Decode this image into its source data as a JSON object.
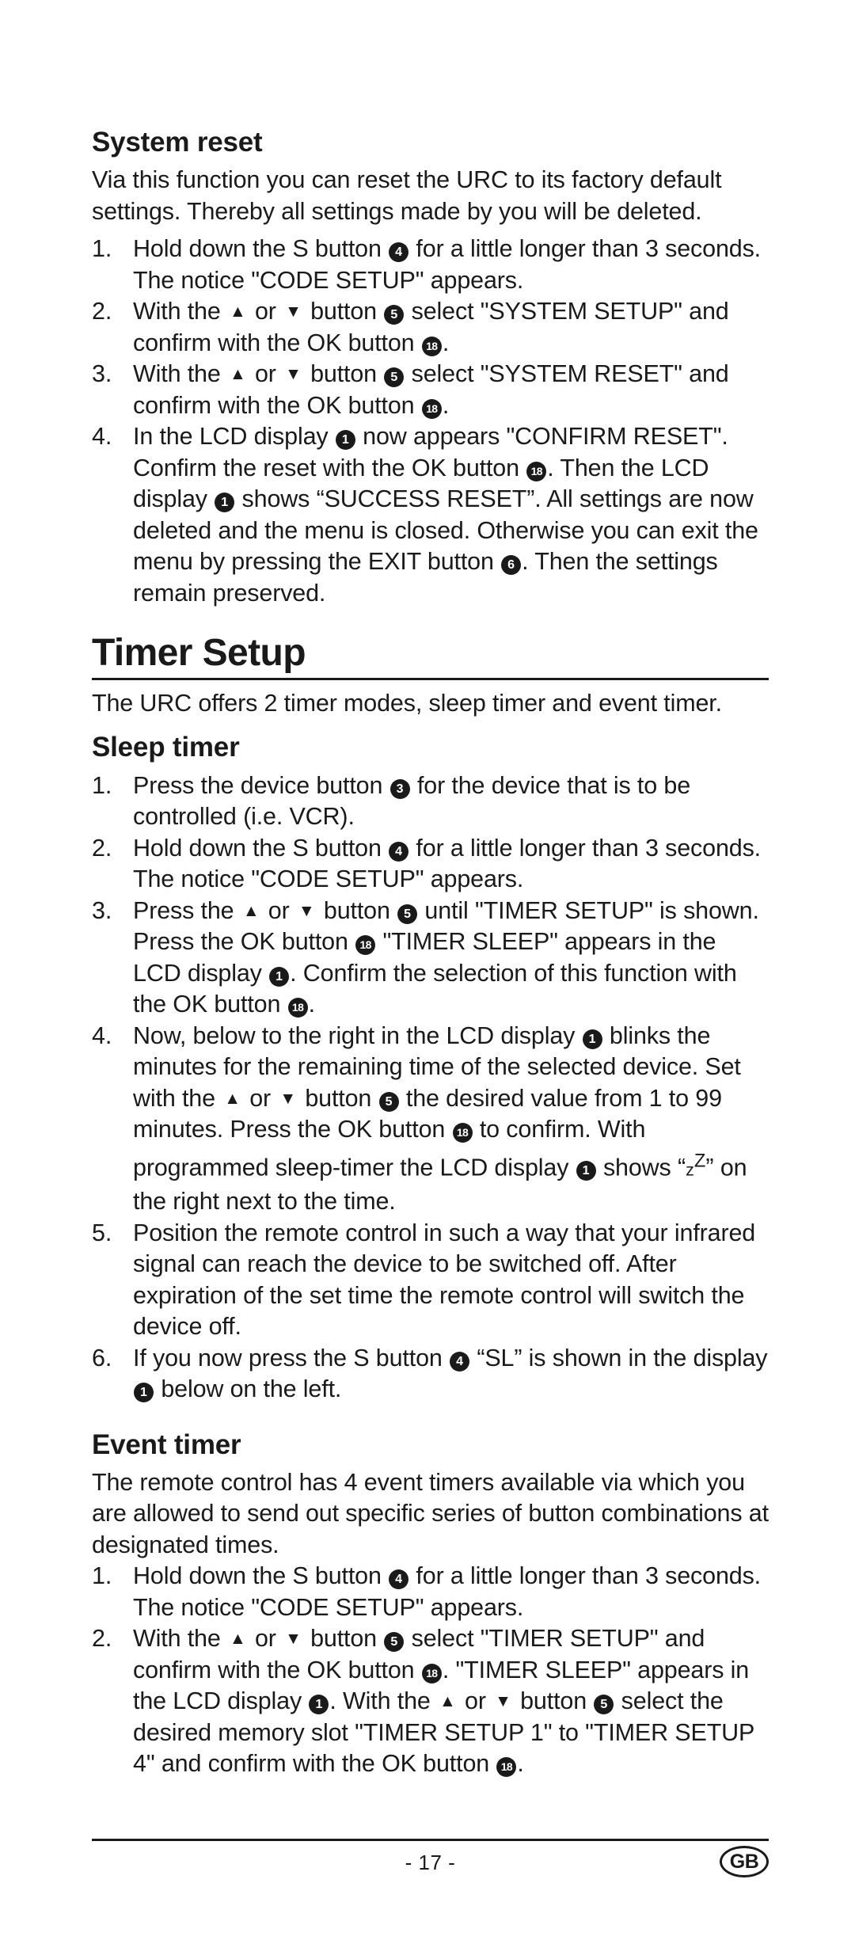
{
  "page": {
    "number_label": "- 17 -",
    "region_badge": "GB"
  },
  "sections": {
    "system_reset": {
      "heading": "System reset",
      "intro": "Via this function you can reset the URC to its factory default settings. Thereby all settings made by you will be deleted.",
      "steps": [
        {
          "num": "1.",
          "parts": [
            {
              "t": "text",
              "v": "Hold down the S button "
            },
            {
              "t": "badge",
              "v": "4"
            },
            {
              "t": "text",
              "v": " for a little longer than 3 seconds. The notice \"CODE SETUP\" appears."
            }
          ]
        },
        {
          "num": "2.",
          "parts": [
            {
              "t": "text",
              "v": "With the "
            },
            {
              "t": "arrow",
              "v": "▲"
            },
            {
              "t": "text",
              "v": " or "
            },
            {
              "t": "arrow",
              "v": "▼"
            },
            {
              "t": "text",
              "v": " button "
            },
            {
              "t": "badge",
              "v": "5"
            },
            {
              "t": "text",
              "v": " select \"SYSTEM SETUP\" and confirm with the OK button "
            },
            {
              "t": "badge",
              "v": "18"
            },
            {
              "t": "text",
              "v": "."
            }
          ]
        },
        {
          "num": "3.",
          "parts": [
            {
              "t": "text",
              "v": "With the "
            },
            {
              "t": "arrow",
              "v": "▲"
            },
            {
              "t": "text",
              "v": " or "
            },
            {
              "t": "arrow",
              "v": "▼"
            },
            {
              "t": "text",
              "v": " button "
            },
            {
              "t": "badge",
              "v": "5"
            },
            {
              "t": "text",
              "v": " select \"SYSTEM RESET\" and confirm with the OK button "
            },
            {
              "t": "badge",
              "v": "18"
            },
            {
              "t": "text",
              "v": "."
            }
          ]
        },
        {
          "num": "4.",
          "parts": [
            {
              "t": "text",
              "v": "In the LCD display "
            },
            {
              "t": "badge",
              "v": "1"
            },
            {
              "t": "text",
              "v": " now appears \"CONFIRM RESET\". Confirm the reset with the OK button "
            },
            {
              "t": "badge",
              "v": "18"
            },
            {
              "t": "text",
              "v": ". Then the LCD display "
            },
            {
              "t": "badge",
              "v": "1"
            },
            {
              "t": "text",
              "v": " shows “SUCCESS RESET”. All settings are now deleted and the menu is closed. Otherwise you can exit the menu by pressing the EXIT button "
            },
            {
              "t": "badge",
              "v": "6"
            },
            {
              "t": "text",
              "v": ". Then the settings remain preserved."
            }
          ]
        }
      ]
    },
    "timer_setup": {
      "heading": "Timer Setup",
      "intro": "The URC offers 2 timer modes, sleep timer and event timer."
    },
    "sleep_timer": {
      "heading": "Sleep timer",
      "steps": [
        {
          "num": "1.",
          "parts": [
            {
              "t": "text",
              "v": "Press the device button "
            },
            {
              "t": "badge",
              "v": "3"
            },
            {
              "t": "text",
              "v": " for the device that is to be controlled (i.e. VCR)."
            }
          ]
        },
        {
          "num": "2.",
          "parts": [
            {
              "t": "text",
              "v": "Hold down the S button "
            },
            {
              "t": "badge",
              "v": "4"
            },
            {
              "t": "text",
              "v": " for a little longer than 3 seconds. The notice \"CODE SETUP\" appears."
            }
          ]
        },
        {
          "num": "3.",
          "parts": [
            {
              "t": "text",
              "v": "Press the "
            },
            {
              "t": "arrow",
              "v": "▲"
            },
            {
              "t": "text",
              "v": " or "
            },
            {
              "t": "arrow",
              "v": "▼"
            },
            {
              "t": "text",
              "v": " button "
            },
            {
              "t": "badge",
              "v": "5"
            },
            {
              "t": "text",
              "v": " until \"TIMER SETUP\" is shown. Press the OK button "
            },
            {
              "t": "badge",
              "v": "18"
            },
            {
              "t": "text",
              "v": " \"TIMER SLEEP\" appears in the LCD display "
            },
            {
              "t": "badge",
              "v": "1"
            },
            {
              "t": "text",
              "v": ".  Confirm the selection of this function with the OK button "
            },
            {
              "t": "badge",
              "v": "18"
            },
            {
              "t": "text",
              "v": "."
            }
          ]
        },
        {
          "num": "4.",
          "parts": [
            {
              "t": "text",
              "v": "Now, below to the right in the LCD display "
            },
            {
              "t": "badge",
              "v": "1"
            },
            {
              "t": "text",
              "v": " blinks the minutes for the remaining time of the selected device. Set with the "
            },
            {
              "t": "arrow",
              "v": "▲"
            },
            {
              "t": "text",
              "v": " or "
            },
            {
              "t": "arrow",
              "v": "▼"
            },
            {
              "t": "text",
              "v": " button "
            },
            {
              "t": "badge",
              "v": "5"
            },
            {
              "t": "text",
              "v": " the desired value from 1 to 99 minutes. Press the OK button "
            },
            {
              "t": "badge",
              "v": "18"
            },
            {
              "t": "text",
              "v": " to confirm. With programmed sleep-timer the LCD display "
            },
            {
              "t": "badge",
              "v": "1"
            },
            {
              "t": "text",
              "v": " shows "
            },
            {
              "t": "zz",
              "v": "“zᶻ”"
            },
            {
              "t": "text",
              "v": " on the right next to the time."
            }
          ]
        },
        {
          "num": "5.",
          "parts": [
            {
              "t": "text",
              "v": "Position the remote control in such a way that your infrared signal can reach the device to be switched off. After expiration of the set time the remote control will switch the device off."
            }
          ]
        },
        {
          "num": "6.",
          "parts": [
            {
              "t": "text",
              "v": "If you now press the S button "
            },
            {
              "t": "badge",
              "v": "4"
            },
            {
              "t": "text",
              "v": " “SL” is shown in the display "
            },
            {
              "t": "badge",
              "v": "1"
            },
            {
              "t": "text",
              "v": " below on the left."
            }
          ]
        }
      ]
    },
    "event_timer": {
      "heading": "Event timer",
      "intro": "The remote control has 4 event timers available via which you are allowed to send out specific series of button combinations at designated times.",
      "steps": [
        {
          "num": "1.",
          "parts": [
            {
              "t": "text",
              "v": "Hold down the S button "
            },
            {
              "t": "badge",
              "v": "4"
            },
            {
              "t": "text",
              "v": " for a little longer than 3 seconds. The notice \"CODE SETUP\" appears."
            }
          ]
        },
        {
          "num": "2.",
          "parts": [
            {
              "t": "text",
              "v": "With the "
            },
            {
              "t": "arrow",
              "v": "▲"
            },
            {
              "t": "text",
              "v": " or "
            },
            {
              "t": "arrow",
              "v": "▼"
            },
            {
              "t": "text",
              "v": " button "
            },
            {
              "t": "badge",
              "v": "5"
            },
            {
              "t": "text",
              "v": " select \"TIMER SETUP\" and confirm with the OK button "
            },
            {
              "t": "badge",
              "v": "18"
            },
            {
              "t": "text",
              "v": ". \"TIMER SLEEP\" appears in the LCD display "
            },
            {
              "t": "badge",
              "v": "1"
            },
            {
              "t": "text",
              "v": ".  With the "
            },
            {
              "t": "arrow",
              "v": "▲"
            },
            {
              "t": "text",
              "v": " or "
            },
            {
              "t": "arrow",
              "v": "▼"
            },
            {
              "t": "text",
              "v": " button "
            },
            {
              "t": "badge",
              "v": "5"
            },
            {
              "t": "text",
              "v": " select the desired memory slot \"TIMER SETUP 1\" to \"TIMER SETUP 4\" and confirm with the OK button "
            },
            {
              "t": "badge",
              "v": "18"
            },
            {
              "t": "text",
              "v": "."
            }
          ]
        }
      ]
    }
  }
}
